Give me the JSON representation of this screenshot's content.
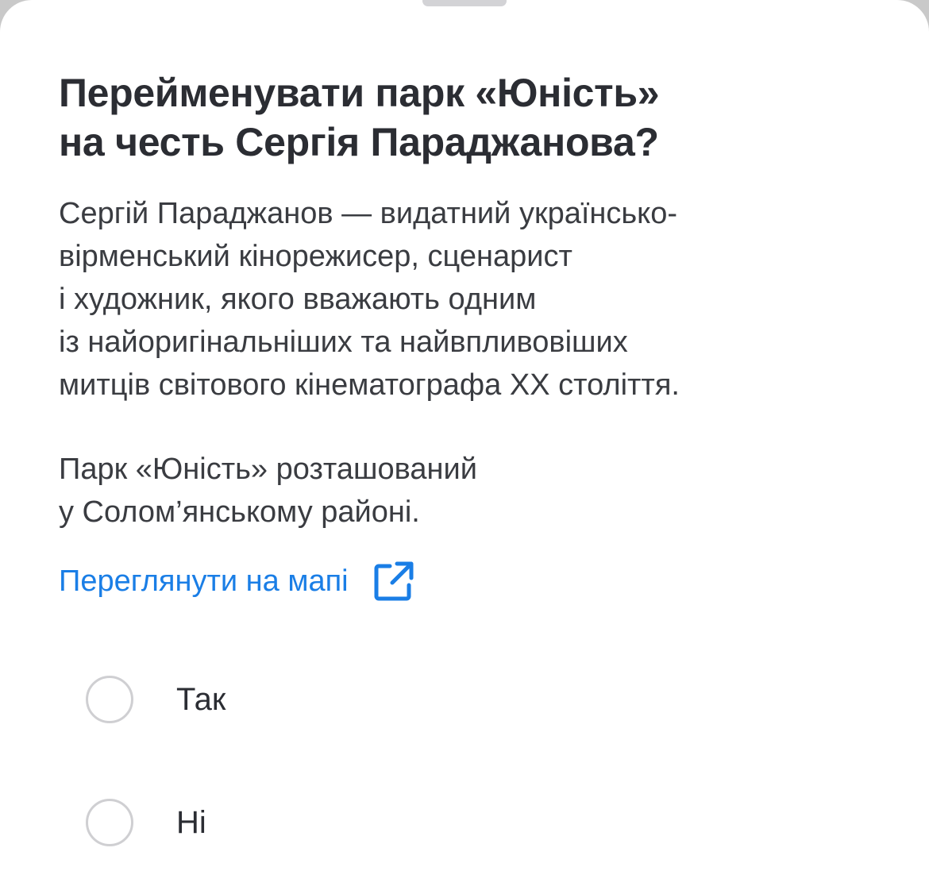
{
  "poll": {
    "title_lines": [
      "Перейменувати парк «Юність»",
      "на честь Сергія Параджанова?"
    ],
    "description_lines": [
      "Сергій Параджанов — видатний українсько-",
      "вірменський кінорежисер, сценарист",
      "і художник, якого вважають одним",
      "із найоригінальніших та найвпливовіших",
      "митців світового кінематографа XX століття."
    ],
    "location_lines": [
      "Парк «Юність» розташований",
      "у Солом’янському районі."
    ],
    "map_link": {
      "label": "Переглянути на мапі",
      "icon": "external-link-icon"
    },
    "options": [
      {
        "label": "Так",
        "selected": false
      },
      {
        "label": "Ні",
        "selected": false
      }
    ]
  },
  "colors": {
    "link": "#1a7ee6",
    "title_text": "#2b2d33",
    "body_text": "#3a3c41",
    "radio_border": "#cfcfd2",
    "grabber": "#d3d3d6"
  }
}
